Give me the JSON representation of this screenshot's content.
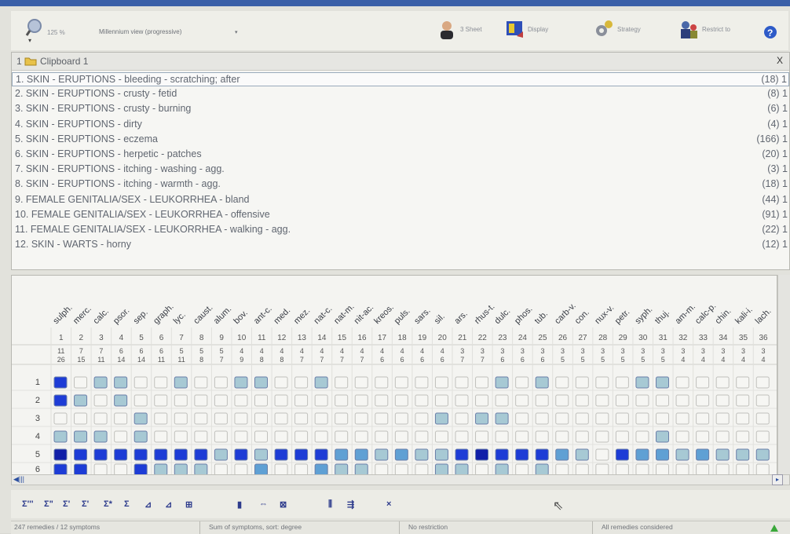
{
  "toolbar": {
    "zoom": "125 %",
    "view_mode": "Millennium view (progressive)",
    "view_caret": "▾",
    "buttons": [
      {
        "label": "3 Sheet",
        "icon": "person-icon"
      },
      {
        "label": "Display",
        "icon": "display-icon"
      },
      {
        "label": "Strategy",
        "icon": "gears-icon"
      },
      {
        "label": "Restrict to",
        "icon": "people-icon"
      }
    ],
    "help_icon": "help-icon"
  },
  "clipboard": {
    "number": "1",
    "title": "Clipboard 1",
    "close_label": "X",
    "rubrics": [
      {
        "text": "1. SKIN - ERUPTIONS - bleeding - scratching; after",
        "count": "(18) 1"
      },
      {
        "text": "2. SKIN - ERUPTIONS - crusty - fetid",
        "count": "(8) 1"
      },
      {
        "text": "3. SKIN - ERUPTIONS - crusty - burning",
        "count": "(6) 1"
      },
      {
        "text": "4. SKIN - ERUPTIONS - dirty",
        "count": "(4) 1"
      },
      {
        "text": "5. SKIN - ERUPTIONS - eczema",
        "count": "(166) 1"
      },
      {
        "text": "6. SKIN - ERUPTIONS - herpetic - patches",
        "count": "(20) 1"
      },
      {
        "text": "7. SKIN - ERUPTIONS - itching - washing - agg.",
        "count": "(3) 1"
      },
      {
        "text": "8. SKIN - ERUPTIONS - itching - warmth - agg.",
        "count": "(18) 1"
      },
      {
        "text": "9. FEMALE GENITALIA/SEX - LEUKORRHEA - bland",
        "count": "(44) 1"
      },
      {
        "text": "10. FEMALE GENITALIA/SEX - LEUKORRHEA - offensive",
        "count": "(91) 1"
      },
      {
        "text": "11. FEMALE GENITALIA/SEX - LEUKORRHEA - walking - agg.",
        "count": "(22) 1"
      },
      {
        "text": "12. SKIN - WARTS - horny",
        "count": "(12) 1"
      }
    ]
  },
  "grid": {
    "remedies": [
      "sulph.",
      "merc.",
      "calc.",
      "psor.",
      "sep.",
      "graph.",
      "lyc.",
      "caust.",
      "alum.",
      "bov.",
      "ant-c.",
      "med.",
      "mez.",
      "nat-c.",
      "nat-m.",
      "nit-ac.",
      "kreos.",
      "puls.",
      "sars.",
      "sil.",
      "ars.",
      "rhus-t.",
      "dulc.",
      "phos.",
      "tub.",
      "carb-v.",
      "con.",
      "nux-v.",
      "petr.",
      "syph.",
      "thuj.",
      "am-m.",
      "calc-p.",
      "chin.",
      "kali-i.",
      "lach."
    ],
    "indices": [
      "1",
      "2",
      "3",
      "4",
      "5",
      "6",
      "7",
      "8",
      "9",
      "10",
      "11",
      "12",
      "13",
      "14",
      "15",
      "16",
      "17",
      "18",
      "19",
      "20",
      "21",
      "22",
      "23",
      "24",
      "25",
      "26",
      "27",
      "28",
      "29",
      "30",
      "31",
      "32",
      "33",
      "34",
      "35",
      "36"
    ],
    "symptom_counts": [
      "11",
      "7",
      "7",
      "6",
      "6",
      "6",
      "5",
      "5",
      "5",
      "4",
      "4",
      "4",
      "4",
      "4",
      "4",
      "4",
      "4",
      "4",
      "4",
      "4",
      "3",
      "3",
      "3",
      "3",
      "3",
      "3",
      "3",
      "3",
      "3",
      "3",
      "3",
      "3",
      "3",
      "3",
      "3",
      "3"
    ],
    "degree_sums": [
      "26",
      "15",
      "11",
      "14",
      "14",
      "11",
      "11",
      "8",
      "7",
      "9",
      "8",
      "8",
      "7",
      "7",
      "7",
      "7",
      "6",
      "6",
      "6",
      "6",
      "7",
      "7",
      "6",
      "6",
      "6",
      "5",
      "5",
      "5",
      "5",
      "5",
      "5",
      "4",
      "4",
      "4",
      "4",
      "4"
    ],
    "row_labels": [
      "1",
      "2",
      "3",
      "4",
      "5",
      "6"
    ],
    "cells": [
      [
        3,
        0,
        1,
        1,
        0,
        0,
        1,
        0,
        0,
        1,
        1,
        0,
        0,
        1,
        0,
        0,
        0,
        0,
        0,
        0,
        0,
        0,
        1,
        0,
        1,
        0,
        0,
        0,
        0,
        1,
        1,
        0,
        0,
        0,
        0,
        0
      ],
      [
        3,
        1,
        0,
        1,
        0,
        0,
        0,
        0,
        0,
        0,
        0,
        0,
        0,
        0,
        0,
        0,
        0,
        0,
        0,
        0,
        0,
        0,
        0,
        0,
        0,
        0,
        0,
        0,
        0,
        0,
        0,
        0,
        0,
        0,
        0,
        0
      ],
      [
        0,
        0,
        0,
        0,
        1,
        0,
        0,
        0,
        0,
        0,
        0,
        0,
        0,
        0,
        0,
        0,
        0,
        0,
        0,
        1,
        0,
        1,
        1,
        0,
        0,
        0,
        0,
        0,
        0,
        0,
        0,
        0,
        0,
        0,
        0,
        0
      ],
      [
        1,
        1,
        1,
        0,
        1,
        0,
        0,
        0,
        0,
        0,
        0,
        0,
        0,
        0,
        0,
        0,
        0,
        0,
        0,
        0,
        0,
        0,
        0,
        0,
        0,
        0,
        0,
        0,
        0,
        0,
        1,
        0,
        0,
        0,
        0,
        0
      ],
      [
        4,
        3,
        3,
        3,
        3,
        3,
        3,
        3,
        1,
        3,
        1,
        3,
        3,
        3,
        2,
        2,
        1,
        2,
        1,
        1,
        3,
        4,
        3,
        3,
        3,
        2,
        1,
        0,
        3,
        2,
        2,
        1,
        2,
        1,
        1,
        1
      ],
      [
        3,
        3,
        0,
        0,
        3,
        1,
        1,
        1,
        0,
        0,
        2,
        0,
        0,
        2,
        1,
        1,
        0,
        0,
        0,
        1,
        1,
        0,
        1,
        0,
        1,
        0,
        0,
        0,
        0,
        0,
        0,
        0,
        0,
        0,
        0,
        0
      ]
    ],
    "colors": {
      "d1": "#a7c9d4",
      "d2": "#5fa0d4",
      "d3": "#1d3cd6",
      "d4": "#111fa8",
      "empty": "#f6f6f3"
    }
  },
  "bottom_tools": [
    "Σ'''",
    "Σ\"",
    "Σ'",
    "Σ'",
    "Σ*",
    "Σ",
    "⊿",
    "⊿",
    "⊞",
    "▮",
    "⇔",
    "⊠",
    "⫼",
    "⇶",
    "×"
  ],
  "status": {
    "summary": "247 remedies / 12 symptoms",
    "sort": "Sum of symptoms, sort: degree",
    "restriction": "No restriction",
    "considered": "All remedies considered"
  }
}
